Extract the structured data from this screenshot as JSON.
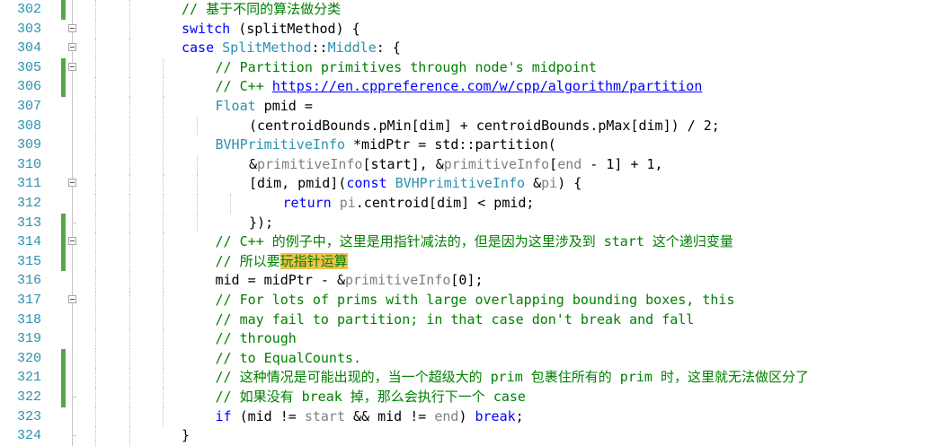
{
  "editor": {
    "lines": [
      {
        "n": "302",
        "indent": 2,
        "mark": true,
        "fold": "line",
        "tokens": [
          {
            "t": "// 基于不同的算法做分类",
            "c": "cm"
          }
        ]
      },
      {
        "n": "303",
        "indent": 2,
        "mark": false,
        "fold": "box",
        "tokens": [
          {
            "t": "switch",
            "c": "kw"
          },
          {
            "t": " (splitMethod) {",
            "c": ""
          }
        ]
      },
      {
        "n": "304",
        "indent": 2,
        "mark": false,
        "fold": "box",
        "tokens": [
          {
            "t": "case",
            "c": "kw"
          },
          {
            "t": " ",
            "c": ""
          },
          {
            "t": "SplitMethod",
            "c": "ty"
          },
          {
            "t": "::",
            "c": ""
          },
          {
            "t": "Middle",
            "c": "ty"
          },
          {
            "t": ": {",
            "c": ""
          }
        ]
      },
      {
        "n": "305",
        "indent": 3,
        "mark": true,
        "fold": "box",
        "tokens": [
          {
            "t": "// Partition primitives through node's midpoint",
            "c": "cm"
          }
        ]
      },
      {
        "n": "306",
        "indent": 3,
        "mark": true,
        "fold": "line",
        "tokens": [
          {
            "t": "// C++ ",
            "c": "cm"
          },
          {
            "t": "https://en.cppreference.com/w/cpp/algorithm/partition",
            "c": "link"
          }
        ]
      },
      {
        "n": "307",
        "indent": 3,
        "mark": false,
        "fold": "line",
        "tokens": [
          {
            "t": "Float",
            "c": "ty"
          },
          {
            "t": " pmid =",
            "c": ""
          }
        ]
      },
      {
        "n": "308",
        "indent": 4,
        "mark": false,
        "fold": "line",
        "tokens": [
          {
            "t": "(centroidBounds.pMin[dim] + centroidBounds.pMax[dim]) / 2;",
            "c": ""
          }
        ]
      },
      {
        "n": "309",
        "indent": 3,
        "mark": false,
        "fold": "line",
        "tokens": [
          {
            "t": "BVHPrimitiveInfo",
            "c": "ty"
          },
          {
            "t": " *midPtr = std::partition(",
            "c": ""
          }
        ]
      },
      {
        "n": "310",
        "indent": 4,
        "mark": false,
        "fold": "line",
        "tokens": [
          {
            "t": "&",
            "c": ""
          },
          {
            "t": "primitiveInfo",
            "c": "par"
          },
          {
            "t": "[start], &",
            "c": ""
          },
          {
            "t": "primitiveInfo",
            "c": "par"
          },
          {
            "t": "[",
            "c": ""
          },
          {
            "t": "end",
            "c": "par"
          },
          {
            "t": " - 1] + 1,",
            "c": ""
          }
        ]
      },
      {
        "n": "311",
        "indent": 4,
        "mark": false,
        "fold": "box",
        "tokens": [
          {
            "t": "[dim, pmid](",
            "c": ""
          },
          {
            "t": "const",
            "c": "kw"
          },
          {
            "t": " ",
            "c": ""
          },
          {
            "t": "BVHPrimitiveInfo",
            "c": "ty"
          },
          {
            "t": " &",
            "c": ""
          },
          {
            "t": "pi",
            "c": "par"
          },
          {
            "t": ") {",
            "c": ""
          }
        ]
      },
      {
        "n": "312",
        "indent": 5,
        "mark": false,
        "fold": "line",
        "tokens": [
          {
            "t": "return",
            "c": "kw"
          },
          {
            "t": " ",
            "c": ""
          },
          {
            "t": "pi",
            "c": "par"
          },
          {
            "t": ".centroid[dim] < pmid;",
            "c": ""
          }
        ]
      },
      {
        "n": "313",
        "indent": 4,
        "mark": true,
        "fold": "end",
        "tokens": [
          {
            "t": "});",
            "c": ""
          }
        ]
      },
      {
        "n": "314",
        "indent": 3,
        "mark": true,
        "fold": "box",
        "tokens": [
          {
            "t": "// C++ 的例子中，这里是用指针减法的，但是因为这里涉及到 start 这个递归变量",
            "c": "cm"
          }
        ]
      },
      {
        "n": "315",
        "indent": 3,
        "mark": true,
        "fold": "line",
        "tokens": [
          {
            "t": "// 所以要",
            "c": "cm"
          },
          {
            "t": "玩指针运算",
            "c": "cm hl"
          }
        ]
      },
      {
        "n": "316",
        "indent": 3,
        "mark": false,
        "fold": "line",
        "tokens": [
          {
            "t": "mid = midPtr - &",
            "c": ""
          },
          {
            "t": "primitiveInfo",
            "c": "par"
          },
          {
            "t": "[0];",
            "c": ""
          }
        ]
      },
      {
        "n": "317",
        "indent": 3,
        "mark": false,
        "fold": "box",
        "tokens": [
          {
            "t": "// For lots of prims with large overlapping bounding boxes, this",
            "c": "cm"
          }
        ]
      },
      {
        "n": "318",
        "indent": 3,
        "mark": false,
        "fold": "line",
        "tokens": [
          {
            "t": "// may fail to partition; in that case don't break and fall",
            "c": "cm"
          }
        ]
      },
      {
        "n": "319",
        "indent": 3,
        "mark": false,
        "fold": "line",
        "tokens": [
          {
            "t": "// through",
            "c": "cm"
          }
        ]
      },
      {
        "n": "320",
        "indent": 3,
        "mark": true,
        "fold": "line",
        "tokens": [
          {
            "t": "// to EqualCounts.",
            "c": "cm"
          }
        ]
      },
      {
        "n": "321",
        "indent": 3,
        "mark": true,
        "fold": "line",
        "tokens": [
          {
            "t": "// 这种情况是可能出现的，当一个超级大的 prim 包裹住所有的 prim 时，这里就无法做区分了",
            "c": "cm"
          }
        ]
      },
      {
        "n": "322",
        "indent": 3,
        "mark": true,
        "fold": "end",
        "tokens": [
          {
            "t": "// 如果没有 break 掉，那么会执行下一个 case",
            "c": "cm"
          }
        ]
      },
      {
        "n": "323",
        "indent": 3,
        "mark": false,
        "fold": "line",
        "tokens": [
          {
            "t": "if",
            "c": "kw"
          },
          {
            "t": " (mid != ",
            "c": ""
          },
          {
            "t": "start",
            "c": "par"
          },
          {
            "t": " && mid != ",
            "c": ""
          },
          {
            "t": "end",
            "c": "par"
          },
          {
            "t": ") ",
            "c": ""
          },
          {
            "t": "break",
            "c": "kw"
          },
          {
            "t": ";",
            "c": ""
          }
        ]
      },
      {
        "n": "324",
        "indent": 2,
        "mark": false,
        "fold": "end",
        "tokens": [
          {
            "t": "}",
            "c": ""
          }
        ]
      }
    ]
  },
  "colors": {
    "keyword": "#0000ff",
    "type": "#2b91af",
    "comment": "#008000",
    "parameter": "#808080",
    "line_number": "#2b91af",
    "change_marker": "#57a64a",
    "highlight": "#f2c14e"
  }
}
